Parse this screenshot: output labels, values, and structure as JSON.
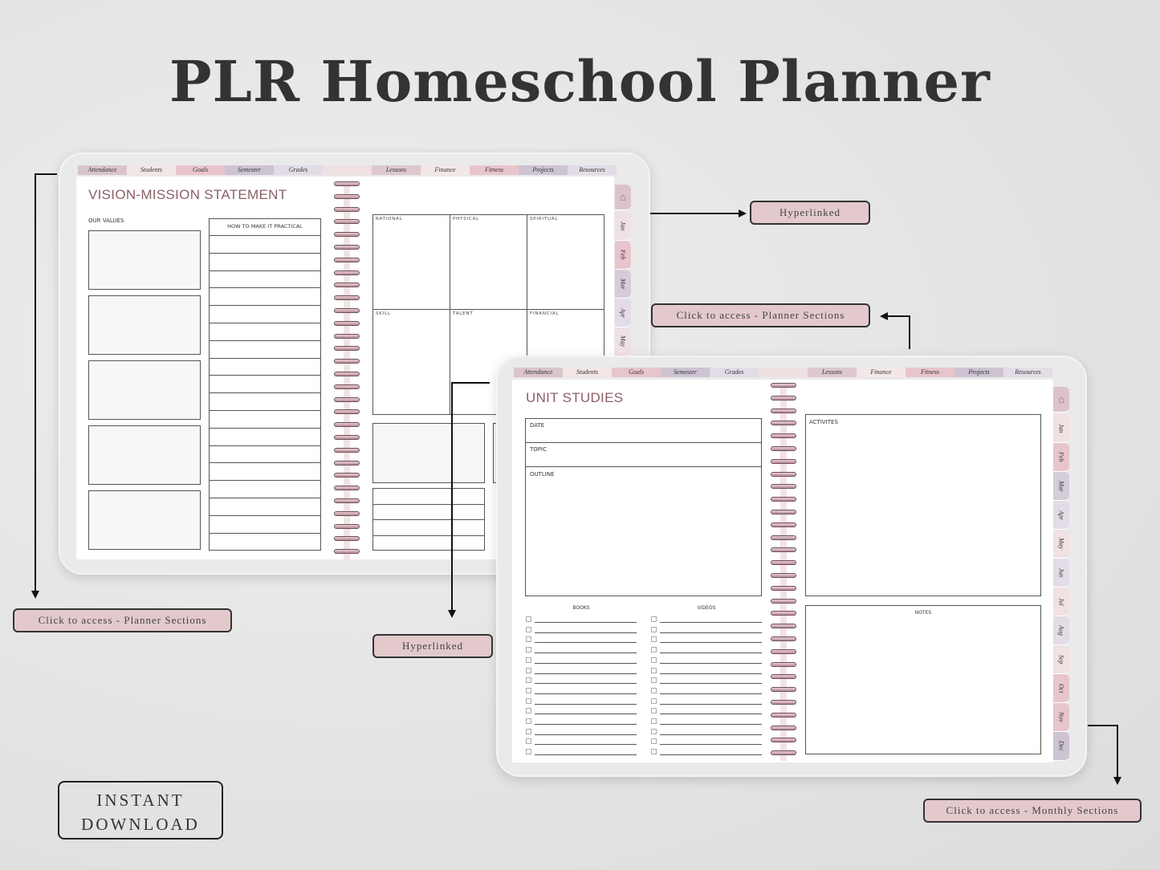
{
  "title": "PLR Homeschool Planner",
  "tabs": [
    {
      "label": "Attendance",
      "color": "#d9c4cc"
    },
    {
      "label": "Students",
      "color": "#f3e6e6"
    },
    {
      "label": "Goals",
      "color": "#e8c5cc"
    },
    {
      "label": "Semester",
      "color": "#cdc3d3"
    },
    {
      "label": "Grades",
      "color": "#e3dce6"
    },
    {
      "label": "",
      "color": "#efe0e2"
    },
    {
      "label": "Lessons",
      "color": "#dcc8ce"
    },
    {
      "label": "Finance",
      "color": "#f3e7e7"
    },
    {
      "label": "Fitness",
      "color": "#e8c5cc"
    },
    {
      "label": "Projects",
      "color": "#cdc3d3"
    },
    {
      "label": "Resources",
      "color": "#e3dce6"
    }
  ],
  "months": [
    "Jan",
    "Feb",
    "Mar",
    "Apr",
    "May",
    "Jun",
    "Jul",
    "Aug",
    "Sep",
    "Oct",
    "Nov",
    "Dec"
  ],
  "month_colors": [
    "#f0e1e3",
    "#e8c5cc",
    "#d6ccd9",
    "#e3dce6",
    "#f0e1e3",
    "#e3dce6",
    "#f0e1e3",
    "#e3dce6",
    "#f0e1e3",
    "#e8c5cc",
    "#e8c5cc",
    "#cdc3d3"
  ],
  "back_page": {
    "title": "VISION-MISSION STATEMENT",
    "our_values": "OUR VALUES",
    "practical": "HOW TO MAKE IT PRACTICAL",
    "grid": [
      "RATIONAL",
      "PHYSICAL",
      "SPIRITUAL",
      "SKILL",
      "TALENT",
      "FINANCIAL"
    ]
  },
  "front_page": {
    "title": "UNIT STUDIES",
    "date": "DATE",
    "topic": "TOPIC",
    "outline": "OUTLINE",
    "books": "BOOKS",
    "videos": "VIDEOS",
    "activities": "ACTIVITES",
    "notes": "NOTES"
  },
  "callouts": {
    "hyperlinked_1": "Hyperlinked",
    "planner_sections_1": "Click to access - Planner Sections",
    "planner_sections_2": "Click to access - Planner Sections",
    "hyperlinked_2": "Hyperlinked",
    "monthly_sections": "Click to access - Monthly Sections"
  },
  "instant_download": {
    "line1": "INSTANT",
    "line2": "DOWNLOAD"
  }
}
